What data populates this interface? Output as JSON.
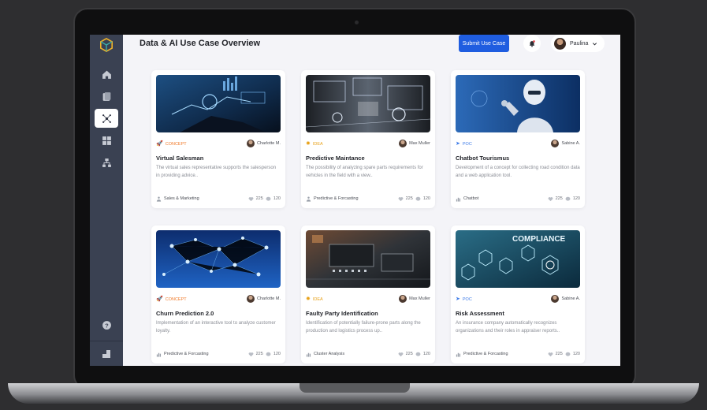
{
  "header": {
    "title": "Data & AI Use Case Overview",
    "submit_label": "Submit Use Case",
    "user_name": "Paulina"
  },
  "colors": {
    "accent": "#1f5de0",
    "sidebar": "#3a4152",
    "concept": "#f07a2a",
    "idea": "#e8a21a",
    "poc": "#3d7be8"
  },
  "sidebar": {
    "items": [
      {
        "icon": "home-icon"
      },
      {
        "icon": "folder-icon"
      },
      {
        "icon": "network-icon",
        "active": true
      },
      {
        "icon": "dashboard-icon"
      },
      {
        "icon": "hierarchy-icon"
      }
    ],
    "bottom": [
      {
        "icon": "help-icon"
      },
      {
        "icon": "layout-icon"
      }
    ]
  },
  "cards": [
    {
      "tag": "CONCEPT",
      "tag_icon": "rocket-icon",
      "author": "Charlotte M.",
      "title": "Virtual Salesman",
      "desc": "The virtual sales representative supports the salesperson in providing advice..",
      "category": "Sales & Marketing",
      "likes": "225",
      "comments": "120"
    },
    {
      "tag": "IDEA",
      "tag_icon": "bulb-icon",
      "author": "Max Muller",
      "title": "Predictive Maintance",
      "desc": "The possibility of analyzing spare parts requirements for vehicles in the field with a view..",
      "category": "Predictive & Forcasting",
      "likes": "225",
      "comments": "120"
    },
    {
      "tag": "POC",
      "tag_icon": "send-icon",
      "author": "Sabine A.",
      "title": "Chatbot Tourismus",
      "desc": "Development of a concept for collecting road condition data and a web application tool.",
      "category": "Chatbot",
      "likes": "225",
      "comments": "120"
    },
    {
      "tag": "CONCEPT",
      "tag_icon": "rocket-icon",
      "author": "Charlotte M.",
      "title": "Churn Prediction 2.0",
      "desc": "Implementation of an interactive tool to analyze customer loyalty.",
      "category": "Predictive & Forcasting",
      "likes": "225",
      "comments": "120"
    },
    {
      "tag": "IDEA",
      "tag_icon": "bulb-icon",
      "author": "Max Muller",
      "title": "Faulty Party Identification",
      "desc": "Identification of potentially failure-prone parts along the production and logistics process up..",
      "category": "Cluster Analysis",
      "likes": "225",
      "comments": "120"
    },
    {
      "tag": "POC",
      "tag_icon": "send-icon",
      "author": "Sabine A.",
      "title": "Risk Assessment",
      "desc": "An insurance company automatically recognizes organizations and their roles in appraiser reports..",
      "category": "Predictive & Forcasting",
      "likes": "225",
      "comments": "120"
    }
  ],
  "card_images": {
    "compliance_text": "COMPLIANCE"
  }
}
